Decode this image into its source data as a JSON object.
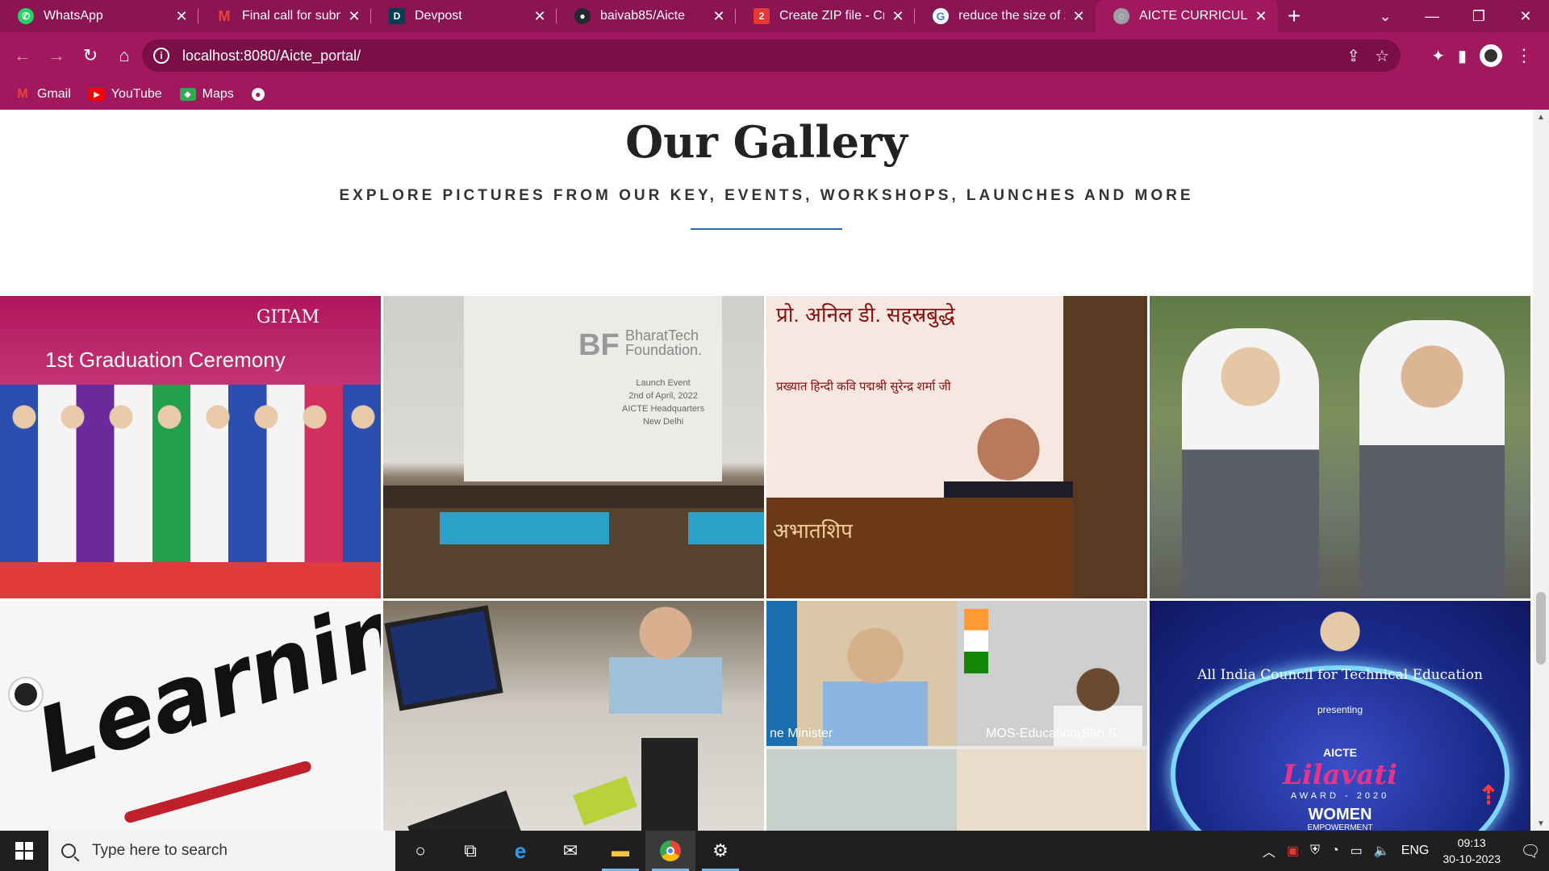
{
  "browser": {
    "tabs": [
      {
        "title": "WhatsApp",
        "favicon": "whatsapp-icon",
        "color": "#25d366",
        "active": false
      },
      {
        "title": "Final call for submissi",
        "favicon": "gmail-icon",
        "color": "#ea4335",
        "active": false
      },
      {
        "title": "Devpost",
        "favicon": "devpost-icon",
        "color": "#003e54",
        "active": false
      },
      {
        "title": "baivab85/Aicte",
        "favicon": "github-icon",
        "color": "#24292e",
        "active": false
      },
      {
        "title": "Create ZIP file - Creat",
        "favicon": "zip-icon",
        "color": "#e53935",
        "active": false
      },
      {
        "title": "reduce the size of zip",
        "favicon": "google-icon",
        "color": "#4285f4",
        "active": false
      },
      {
        "title": "AICTE CURRICULAM",
        "favicon": "globe-icon",
        "color": "#9aa0a6",
        "active": true
      }
    ],
    "close_glyph": "✕",
    "new_tab_glyph": "+",
    "url": "localhost:8080/Aicte_portal/",
    "bookmarks": [
      {
        "label": "Gmail",
        "icon": "gmail-icon",
        "color": "#ea4335"
      },
      {
        "label": "YouTube",
        "icon": "youtube-icon",
        "color": "#ff0000"
      },
      {
        "label": "Maps",
        "icon": "maps-icon",
        "color": "#34a853"
      }
    ]
  },
  "gallery": {
    "title": "Our Gallery",
    "subtitle": "EXPLORE PICTURES FROM OUR KEY, EVENTS, WORKSHOPS, LAUNCHES AND MORE",
    "accent": "#2f68b3",
    "images": [
      {
        "name": "graduation-ceremony",
        "text": [
          "GITAM",
          "1st Graduation Ceremony"
        ]
      },
      {
        "name": "bharattech-launch",
        "text": [
          "BF",
          "BharatTech",
          "Foundation.",
          "Launch Event",
          "2nd of April, 2022",
          "AICTE Headquarters",
          "New Delhi"
        ]
      },
      {
        "name": "hindi-book-launch",
        "text": [
          "प्रो. अनिल डी. सहस्रबुद्धे",
          "प्रख्यात हिन्दी कवि पद्मश्री सुरेन्द्र शर्मा जी",
          "अभातशिप"
        ]
      },
      {
        "name": "ladakh-students",
        "text": []
      },
      {
        "name": "learning",
        "text": [
          "Learning"
        ]
      },
      {
        "name": "workshop-desk",
        "text": []
      },
      {
        "name": "video-conference",
        "text": [
          "ne Minister",
          "MOS-Education(Shri S"
        ]
      },
      {
        "name": "lilavati-award",
        "text": [
          "All India Council for Technical Education",
          "presenting",
          "AICTE",
          "Lilavati",
          "AWARD - 2020",
          "WOMEN",
          "EMPOWERMENT"
        ]
      }
    ]
  },
  "taskbar": {
    "search_placeholder": "Type here to search",
    "language": "ENG",
    "time": "09:13",
    "date": "30-10-2023"
  }
}
